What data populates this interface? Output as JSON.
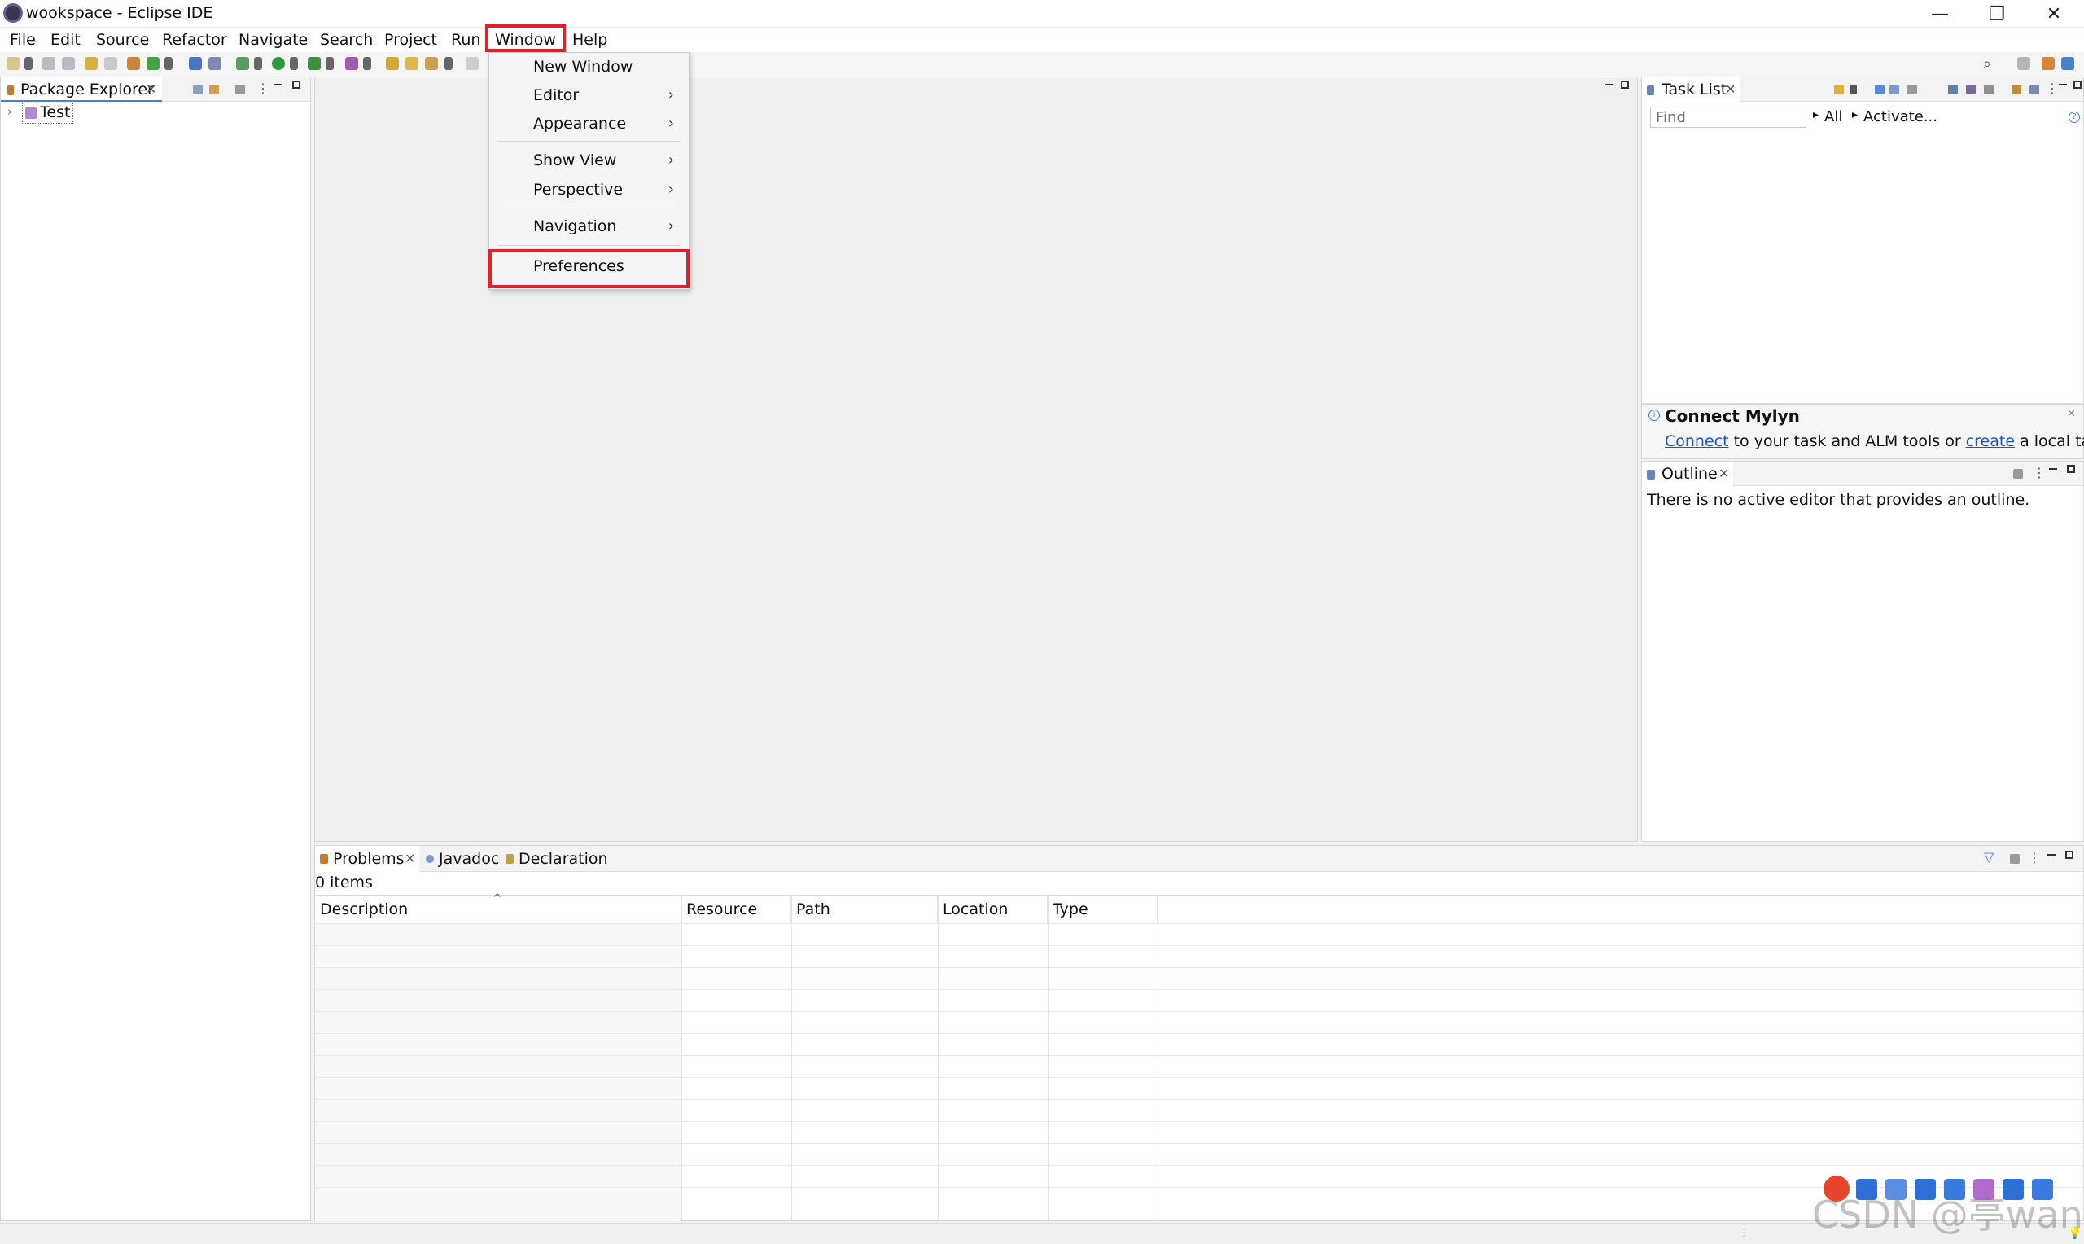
{
  "window": {
    "title": "wookspace - Eclipse IDE"
  },
  "titlebar_buttons": {
    "minimize": "—",
    "restore": "❐",
    "close": "✕"
  },
  "menubar": [
    "File",
    "Edit",
    "Source",
    "Refactor",
    "Navigate",
    "Search",
    "Project",
    "Run",
    "Window",
    "Help"
  ],
  "window_menu": {
    "items": [
      {
        "label": "New Window",
        "submenu": false
      },
      {
        "label": "Editor",
        "submenu": true
      },
      {
        "label": "Appearance",
        "submenu": true
      },
      {
        "label": "Show View",
        "submenu": true
      },
      {
        "label": "Perspective",
        "submenu": true
      },
      {
        "label": "Navigation",
        "submenu": true
      },
      {
        "label": "Preferences",
        "submenu": false
      }
    ],
    "arrow": "›"
  },
  "package_explorer": {
    "tab": "Package Explorer",
    "close": "✕",
    "tree": [
      {
        "label": "Test",
        "expand": "›"
      }
    ]
  },
  "task_list": {
    "tab": "Task List",
    "close": "✕",
    "find_placeholder": "Find",
    "all_label": "All",
    "activate_label": "Activate...",
    "tri": "▸"
  },
  "connect_mylyn": {
    "title": "Connect Mylyn",
    "connect_link": "Connect",
    "middle_text": "to your task and ALM tools or",
    "create_link": "create",
    "end_text": "a local task."
  },
  "outline": {
    "tab": "Outline",
    "close": "✕",
    "message": "There is no active editor that provides an outline."
  },
  "problems": {
    "tabs": [
      {
        "label": "Problems",
        "close": "✕"
      },
      {
        "label": "Javadoc"
      },
      {
        "label": "Declaration"
      }
    ],
    "count_text": "0 items",
    "columns": [
      "Description",
      "Resource",
      "Path",
      "Location",
      "Type"
    ],
    "sort_indicator": "^"
  },
  "watermark": "CSDN @亭wan",
  "colors": {
    "highlight": "#e0202a",
    "link": "#1a55c9"
  }
}
